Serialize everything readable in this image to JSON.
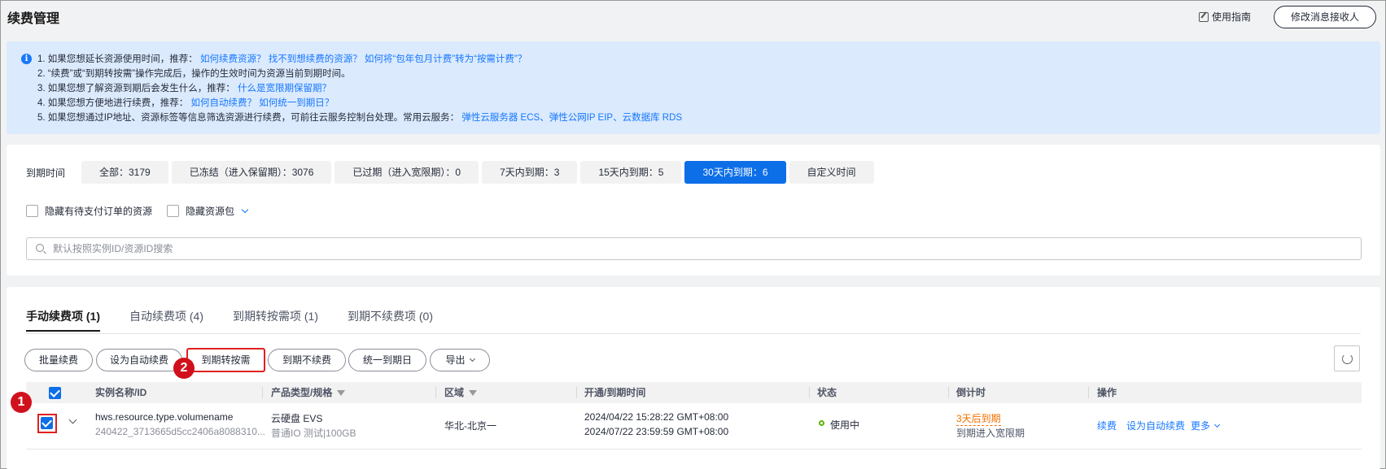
{
  "header": {
    "title": "续费管理",
    "guide_label": "使用指南",
    "receiver_button": "修改消息接收人"
  },
  "notice": {
    "lines": [
      {
        "text": "1. 如果您想延长资源使用时间，推荐：",
        "links": [
          "如何续费资源？",
          "找不到想续费的资源？",
          "如何将“包年包月计费”转为“按需计费”？"
        ]
      },
      {
        "text": "2. “续费”或“到期转按需”操作完成后，操作的生效时间为资源当前到期时间。",
        "links": []
      },
      {
        "text": "3. 如果您想了解资源到期后会发生什么，推荐：",
        "links": [
          "什么是宽限期保留期？"
        ]
      },
      {
        "text": "4. 如果您想方便地进行续费，推荐：",
        "links": [
          "如何自动续费？",
          "如何统一到期日？"
        ]
      },
      {
        "text": "5. 如果您想通过IP地址、资源标签等信息筛选资源进行续费，可前往云服务控制台处理。常用云服务：",
        "links": [
          "弹性云服务器 ECS、",
          "弹性公网IP EIP、",
          "云数据库 RDS"
        ]
      }
    ]
  },
  "filters": {
    "expiry_label": "到期时间",
    "chips": [
      {
        "label": "全部：3179",
        "active": false
      },
      {
        "label": "已冻结（进入保留期）：3076",
        "active": false
      },
      {
        "label": "已过期（进入宽限期）：0",
        "active": false
      },
      {
        "label": "7天内到期：3",
        "active": false
      },
      {
        "label": "15天内到期：5",
        "active": false
      },
      {
        "label": "30天内到期：6",
        "active": true
      },
      {
        "label": "自定义时间",
        "active": false
      }
    ],
    "hide_pending_label": "隐藏有待支付订单的资源",
    "hide_package_label": "隐藏资源包",
    "search_placeholder": "默认按照实例ID/资源ID搜索"
  },
  "tabs": [
    {
      "label": "手动续费项 (1)",
      "active": true
    },
    {
      "label": "自动续费项 (4)",
      "active": false
    },
    {
      "label": "到期转按需项 (1)",
      "active": false
    },
    {
      "label": "到期不续费项 (0)",
      "active": false
    }
  ],
  "toolbar": {
    "batch_renew": "批量续费",
    "set_auto_renew": "设为自动续费",
    "to_on_demand": "到期转按需",
    "no_renew": "到期不续费",
    "unify_date": "统一到期日",
    "export": "导出"
  },
  "table": {
    "columns": [
      "实例名称/ID",
      "产品类型/规格",
      "区域",
      "开通/到期时间",
      "状态",
      "倒计时",
      "操作"
    ],
    "rows": [
      {
        "name": "hws.resource.type.volumename",
        "id": "240422_3713665d5cc2406a8088310...",
        "product": "云硬盘 EVS",
        "spec": "普通IO 测试|100GB",
        "region": "华北-北京一",
        "start_time": "2024/04/22 15:28:22 GMT+08:00",
        "end_time": "2024/07/22 23:59:59 GMT+08:00",
        "status": "使用中",
        "countdown": "3天后到期",
        "countdown_note": "到期进入宽限期",
        "actions": {
          "renew": "续费",
          "auto": "设为自动续费",
          "more": "更多"
        }
      }
    ]
  },
  "badges": {
    "step1": "1",
    "step2": "2"
  },
  "colors": {
    "primary": "#0d6fe8",
    "link": "#1677ff",
    "highlight": "#e02020",
    "warning": "#f66f00",
    "ok": "#5bb600"
  }
}
